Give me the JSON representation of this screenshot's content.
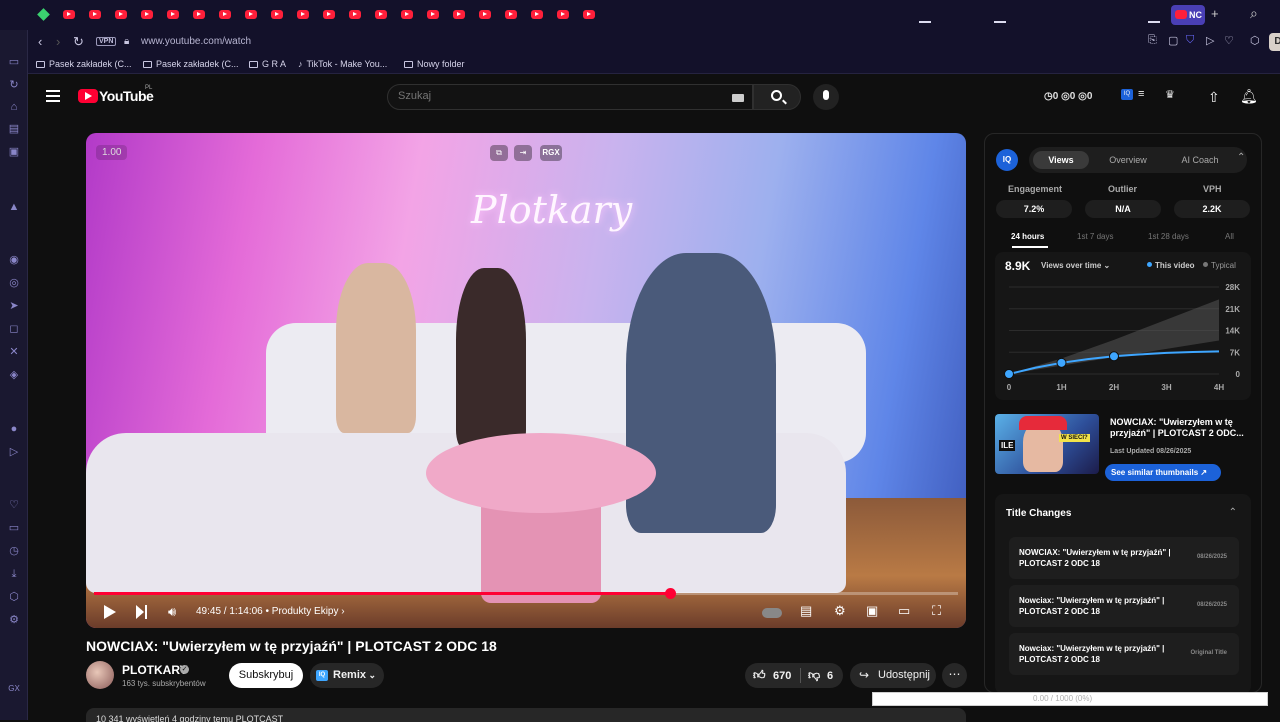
{
  "browser": {
    "tab_count_icons": 21,
    "active_tab_label": "NC",
    "url": "www.youtube.com/watch",
    "vpn_label": "VPN",
    "profile_initial": "D",
    "bookmarks": [
      {
        "label": "Pasek zakładek (C...",
        "icon": "folder-icon"
      },
      {
        "label": "Pasek zakładek (C...",
        "icon": "folder-icon"
      },
      {
        "label": "G R A",
        "icon": "folder-icon"
      },
      {
        "label": "TikTok - Make You...",
        "icon": "tiktok-icon"
      },
      {
        "label": "Nowy folder",
        "icon": "folder-icon"
      }
    ]
  },
  "youtube": {
    "wordmark": "YouTube",
    "country": "PL",
    "search_placeholder": "Szukaj",
    "counters": "◷0 ◎0 ◎0"
  },
  "video": {
    "speed": "1.00",
    "overlay_tool_label": "RGX",
    "neon_sign": "Plotkary",
    "progress_percent": 66.7,
    "time": "49:45 / 1:14:06",
    "chapter": "• Produkty Ekipy ›",
    "title": "NOWCIAX: \"Uwierzyłem w tę przyjaźń\" | PLOTCAST 2 ODC 18",
    "channel_name": "PLOTKARY",
    "verified_mark": "✓",
    "subscribers": "163 tys. subskrybentów",
    "subscribe_label": "Subskrybuj",
    "remix_label": "Remix",
    "likes": "670",
    "dislikes": "6",
    "share_label": "Udostępnij",
    "more_label": "⋯",
    "description_teaser": "10 341 wyświetleń  4 godziny temu  PLOTCAST"
  },
  "vidiq": {
    "logo": "IQ",
    "tabs": [
      "Views",
      "Overview",
      "AI Coach"
    ],
    "active_tab": "Views",
    "metrics": [
      {
        "label": "Engagement",
        "value": "7.2%"
      },
      {
        "label": "Outlier",
        "value": "N/A"
      },
      {
        "label": "VPH",
        "value": "2.2K"
      }
    ],
    "ranges": [
      "24 hours",
      "1st 7 days",
      "1st 28 days",
      "All"
    ],
    "active_range": "24 hours",
    "views_total": "8.9K",
    "views_over_time": "Views over time ⌄",
    "legend_this": "This video",
    "legend_typical": "Typical",
    "similar": {
      "title": "NOWCIAX: \"Uwierzyłem w tę przyjaźń\" | PLOTCAST 2 ODC...",
      "updated": "Last Updated 08/26/2025",
      "button": "See similar thumbnails ↗",
      "thumb_tag1": "ILE",
      "thumb_tag2": "W SIECI?"
    },
    "title_changes_heading": "Title Changes",
    "title_changes": [
      {
        "text": "NOWCIAX: \"Uwierzyłem w tę przyjaźń\" | PLOTCAST 2 ODC 18",
        "date": "08/26/2025"
      },
      {
        "text": "Nowciax: \"Uwierzyłem w tę przyjaźń\" | PLOTCAST 2 ODC 18",
        "date": "08/26/2025"
      },
      {
        "text": "Nowciax: \"Uwierzyłem w tę przyjaźń\" | PLOTCAST 2 ODC 18",
        "date": "Original Title"
      }
    ]
  },
  "chart_data": {
    "type": "area",
    "x_ticks": [
      "0",
      "1H",
      "2H",
      "3H",
      "4H"
    ],
    "y_ticks": [
      "28K",
      "21K",
      "14K",
      "7K",
      "0"
    ],
    "ylim": [
      0,
      28000
    ],
    "xlim": [
      0,
      4
    ],
    "series": [
      {
        "name": "This video",
        "x": [
          0,
          0.5,
          1,
          1.5,
          2,
          2.5,
          3,
          3.5,
          4
        ],
        "y": [
          0,
          2000,
          3600,
          4800,
          5700,
          6300,
          6800,
          7100,
          7300
        ]
      },
      {
        "name": "Typical",
        "x": [
          0,
          1,
          2,
          3,
          4
        ],
        "y": [
          0,
          5000,
          11000,
          17500,
          24000
        ]
      }
    ],
    "markers": [
      0,
      1,
      2
    ],
    "colors": {
      "this": "#3ea6ff",
      "typical": "#555555"
    }
  },
  "overlay": {
    "text": "0.00 / 1000 (0%)"
  }
}
